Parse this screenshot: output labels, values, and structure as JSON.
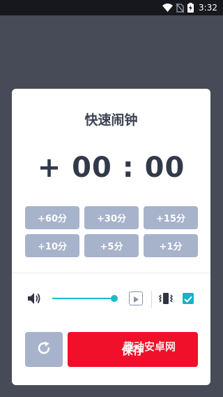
{
  "status_bar": {
    "time": "3:32",
    "icons": [
      "wifi-icon",
      "no-sim-icon",
      "battery-charging-icon"
    ]
  },
  "dialog": {
    "title": "快速闹钟",
    "time_display": "+ 00 : 00",
    "presets": [
      {
        "label": "+60分"
      },
      {
        "label": "+30分"
      },
      {
        "label": "+15分"
      },
      {
        "label": "+10分"
      },
      {
        "label": "+5分"
      },
      {
        "label": "+1分"
      }
    ],
    "volume": {
      "icon": "volume-icon",
      "level": 1.0
    },
    "vibrate": {
      "icon": "vibrate-icon",
      "checked": true
    },
    "reset_icon": "refresh-icon",
    "save_label": "保存",
    "watermark": "趣动安卓网"
  },
  "colors": {
    "accent": "#1fbac7",
    "preset_bg": "#a7b3cb",
    "save_bg": "#f01029",
    "backdrop": "#464b57"
  }
}
